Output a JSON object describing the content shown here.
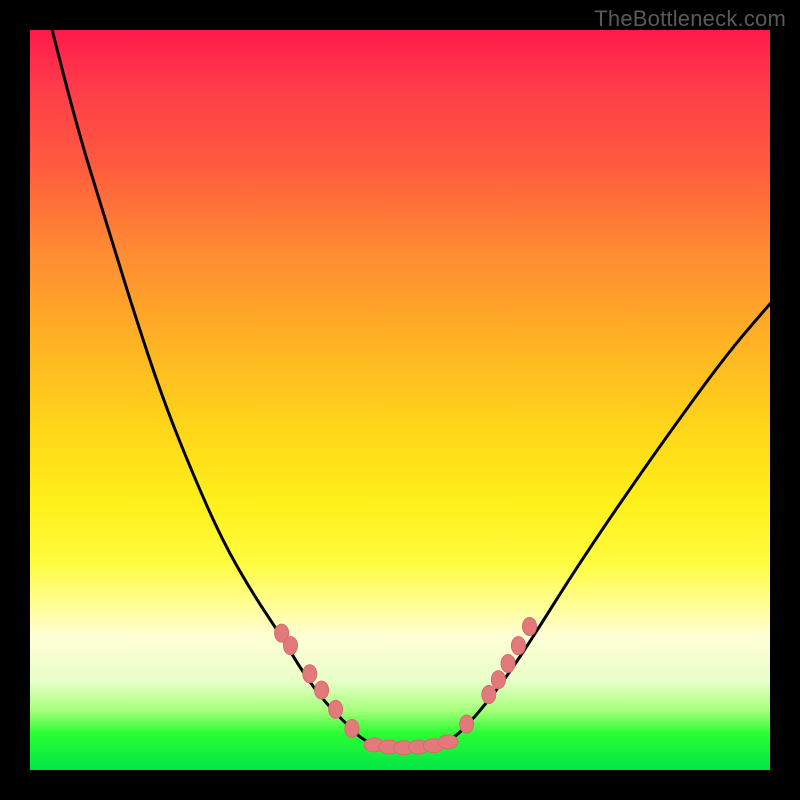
{
  "watermark": "TheBottleneck.com",
  "colors": {
    "frame": "#000000",
    "curve": "#000000",
    "dot_fill": "#e27a7c",
    "dot_stroke": "#d76a6c",
    "gradient_top": "#ff1a4a",
    "gradient_bottom": "#00e646"
  },
  "chart_data": {
    "type": "line",
    "title": "",
    "xlabel": "",
    "ylabel": "",
    "xlim": [
      0,
      100
    ],
    "ylim": [
      0,
      100
    ],
    "note": "Axes are unlabeled; values below are estimated from pixel positions on a 0–100 normalized grid (x left→right, y bottom→top).",
    "series": [
      {
        "name": "left-arm",
        "x": [
          3,
          6,
          10,
          14,
          18,
          22,
          26,
          30,
          34,
          37,
          40,
          43,
          45
        ],
        "y": [
          100,
          88,
          75,
          62,
          50,
          40,
          31,
          24,
          18,
          13,
          9,
          6,
          4
        ]
      },
      {
        "name": "valley-floor",
        "x": [
          45,
          48,
          51,
          54,
          57
        ],
        "y": [
          4,
          3,
          3,
          3,
          4
        ]
      },
      {
        "name": "right-arm",
        "x": [
          57,
          60,
          64,
          68,
          73,
          79,
          86,
          94,
          100
        ],
        "y": [
          4,
          7,
          12,
          18,
          26,
          35,
          45,
          56,
          63
        ]
      }
    ],
    "dots_left_arm": [
      {
        "x": 34.0,
        "y": 18.5
      },
      {
        "x": 35.2,
        "y": 16.8
      },
      {
        "x": 37.8,
        "y": 13.0
      },
      {
        "x": 39.4,
        "y": 10.8
      },
      {
        "x": 41.3,
        "y": 8.2
      },
      {
        "x": 43.5,
        "y": 5.6
      }
    ],
    "dots_valley": [
      {
        "x": 46.5,
        "y": 3.4
      },
      {
        "x": 48.5,
        "y": 3.1
      },
      {
        "x": 50.5,
        "y": 3.0
      },
      {
        "x": 52.5,
        "y": 3.1
      },
      {
        "x": 54.5,
        "y": 3.3
      },
      {
        "x": 56.5,
        "y": 3.8
      }
    ],
    "dots_right_arm": [
      {
        "x": 59.0,
        "y": 6.2
      },
      {
        "x": 62.0,
        "y": 10.2
      },
      {
        "x": 63.3,
        "y": 12.2
      },
      {
        "x": 64.6,
        "y": 14.4
      },
      {
        "x": 66.0,
        "y": 16.8
      },
      {
        "x": 67.5,
        "y": 19.4
      }
    ]
  }
}
